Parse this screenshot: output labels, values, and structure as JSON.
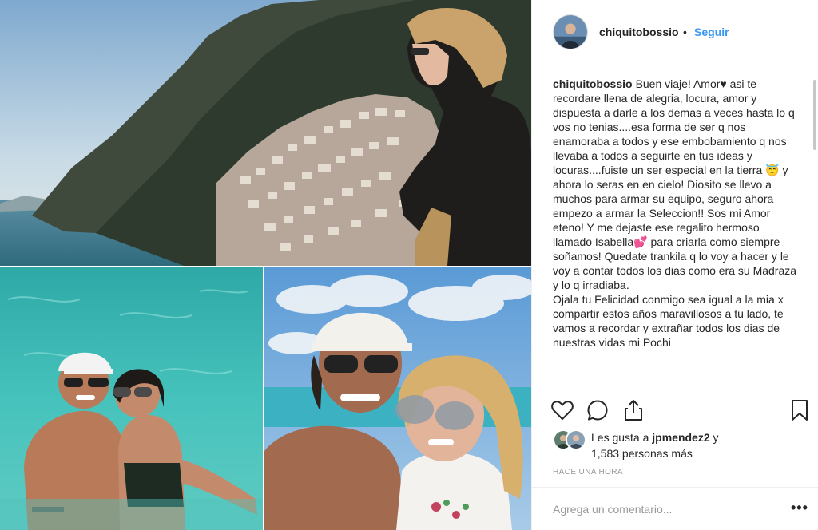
{
  "post": {
    "username": "chiquitobossio",
    "separator": "•",
    "follow_label": "Seguir",
    "caption_user": "chiquitobossio",
    "caption_text": "Buen viaje! Amor♥ asi te recordare llena de alegria, locura, amor y dispuesta a darle a los demas a veces hasta lo q vos no tenias....esa forma de ser q nos enamoraba a todos y ese embobamiento q nos llevaba a todos a seguirte en tus ideas y locuras....fuiste un ser especial en la tierra 😇 y ahora lo seras en en cielo! Diosito se llevo a muchos para armar su equipo, seguro ahora empezo a armar la Seleccion!! Sos mi Amor eteno! Y me dejaste ese regalito hermoso llamado Isabella💕 para criarla como siempre soñamos! Quedate trankila q lo voy a hacer y le voy a contar todos los dias como era su Madraza y lo q irradiaba.\nOjala tu Felicidad conmigo sea igual a la mia x compartir estos años maravillosos a tu lado, te vamos a recordar y extrañar todos los dias de nuestras vidas mi Pochi"
  },
  "likes": {
    "prefix": "Les gusta a ",
    "liker": "jpmendez2",
    "suffix": " y",
    "count_text": "1,583 personas más"
  },
  "time_ago": "HACE UNA HORA",
  "comment": {
    "placeholder": "Agrega un comentario..."
  },
  "more_label": "•••",
  "icons": {
    "like": "heart-icon",
    "comment": "comment-icon",
    "share": "share-icon",
    "save": "bookmark-icon"
  },
  "colors": {
    "follow": "#3897f0",
    "text": "#262626",
    "muted": "#999999",
    "border": "#efefef"
  }
}
